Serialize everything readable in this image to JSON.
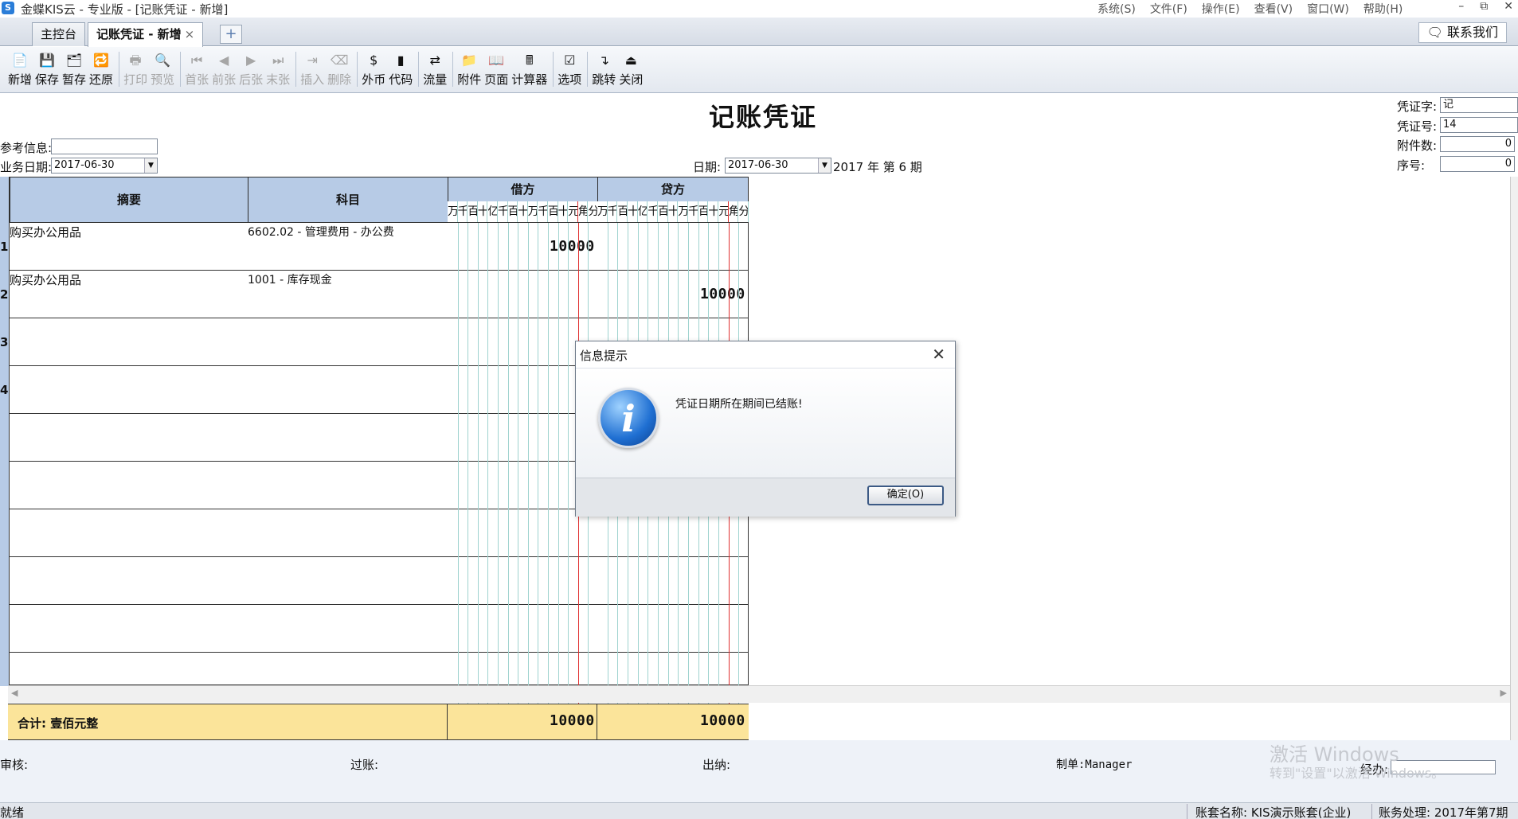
{
  "titlebar": {
    "app_icon": "S",
    "title": "金蝶KIS云 - 专业版 - [记账凭证 - 新增]",
    "menus": [
      "系统(S)",
      "文件(F)",
      "操作(E)",
      "查看(V)",
      "窗口(W)",
      "帮助(H)"
    ],
    "min_icon": "–",
    "restore_icon": "⧉",
    "close_icon": "✕"
  },
  "tabs": {
    "home": "主控台",
    "active": "记账凭证 - 新增",
    "close_glyph": "×",
    "add_glyph": "+",
    "contact": "联系我们"
  },
  "toolbar": {
    "buttons": [
      {
        "label": "新增",
        "icon": "📄",
        "disabled": false
      },
      {
        "label": "保存",
        "icon": "💾",
        "disabled": false
      },
      {
        "label": "暂存",
        "icon": "🗂",
        "disabled": false
      },
      {
        "label": "还原",
        "icon": "🔁",
        "disabled": false
      },
      {
        "label": "打印",
        "icon": "🖶",
        "disabled": true
      },
      {
        "label": "预览",
        "icon": "🔍",
        "disabled": true
      },
      {
        "label": "首张",
        "icon": "⏮",
        "disabled": true
      },
      {
        "label": "前张",
        "icon": "◀",
        "disabled": true
      },
      {
        "label": "后张",
        "icon": "▶",
        "disabled": true
      },
      {
        "label": "末张",
        "icon": "⏭",
        "disabled": true
      },
      {
        "label": "插入",
        "icon": "⇥",
        "disabled": true
      },
      {
        "label": "删除",
        "icon": "⌫",
        "disabled": true
      },
      {
        "label": "外币",
        "icon": "$",
        "disabled": false
      },
      {
        "label": "代码",
        "icon": "▮",
        "disabled": false
      },
      {
        "label": "流量",
        "icon": "⇄",
        "disabled": false
      },
      {
        "label": "附件",
        "icon": "📁",
        "disabled": false
      },
      {
        "label": "页面",
        "icon": "📖",
        "disabled": false
      },
      {
        "label": "计算器",
        "icon": "🖩",
        "disabled": false
      },
      {
        "label": "选项",
        "icon": "☑",
        "disabled": false
      },
      {
        "label": "跳转",
        "icon": "↴",
        "disabled": false
      },
      {
        "label": "关闭",
        "icon": "⏏",
        "disabled": false
      }
    ]
  },
  "voucher": {
    "title": "记账凭证",
    "ref_label": "参考信息:",
    "ref_value": "",
    "biz_date_label": "业务日期:",
    "biz_date": "2017-06-30",
    "date_label": "日期:",
    "date": "2017-06-30",
    "period": "2017 年 第 6 期",
    "word_label": "凭证字:",
    "word": "记",
    "number_label": "凭证号:",
    "number": "14",
    "attachments_label": "附件数:",
    "attachments": "0",
    "seq_label": "序号:",
    "seq": "0"
  },
  "grid": {
    "headers": {
      "summary": "摘要",
      "account": "科目",
      "debit": "借方",
      "credit": "贷方"
    },
    "digits": [
      "万",
      "千",
      "百",
      "十",
      "亿",
      "千",
      "百",
      "十",
      "万",
      "千",
      "百",
      "十",
      "元",
      "角",
      "分"
    ],
    "rows": [
      {
        "no": "1",
        "summary": "购买办公用品",
        "account": "6602.02 - 管理费用 - 办公费",
        "debit": "10000",
        "credit": ""
      },
      {
        "no": "2",
        "summary": "购买办公用品",
        "account": "1001 - 库存现金",
        "debit": "",
        "credit": "10000"
      },
      {
        "no": "3",
        "summary": "",
        "account": "",
        "debit": "",
        "credit": ""
      },
      {
        "no": "4",
        "summary": "",
        "account": "",
        "debit": "",
        "credit": ""
      },
      {
        "no": "",
        "summary": "",
        "account": "",
        "debit": "",
        "credit": ""
      },
      {
        "no": "",
        "summary": "",
        "account": "",
        "debit": "",
        "credit": ""
      },
      {
        "no": "",
        "summary": "",
        "account": "",
        "debit": "",
        "credit": ""
      },
      {
        "no": "",
        "summary": "",
        "account": "",
        "debit": "",
        "credit": ""
      },
      {
        "no": "",
        "summary": "",
        "account": "",
        "debit": "",
        "credit": ""
      },
      {
        "no": "",
        "summary": "",
        "account": "",
        "debit": "",
        "credit": ""
      }
    ],
    "total_label": "合计: 壹佰元整",
    "total_debit": "10000",
    "total_credit": "10000"
  },
  "footer": {
    "review": "审核:",
    "post": "过账:",
    "cashier": "出纳:",
    "maker": "制单:Manager",
    "handler": "经办:",
    "watermark_line1": "激活 Windows",
    "watermark_line2": "转到\"设置\"以激活 Windows。"
  },
  "status": {
    "left": "就绪",
    "account_set": "账套名称: KIS演示账套(企业)",
    "processing": "账务处理: 2017年第7期"
  },
  "dialog": {
    "title": "信息提示",
    "message": "凭证日期所在期间已结账!",
    "ok": "确定(O)",
    "icon_glyph": "i",
    "close_glyph": "✕"
  },
  "colors": {
    "header_blue": "#b7cbe6",
    "total_yellow": "#fbe49a",
    "decimal_red": "#e03030",
    "digit_teal": "#9fd3cf"
  }
}
